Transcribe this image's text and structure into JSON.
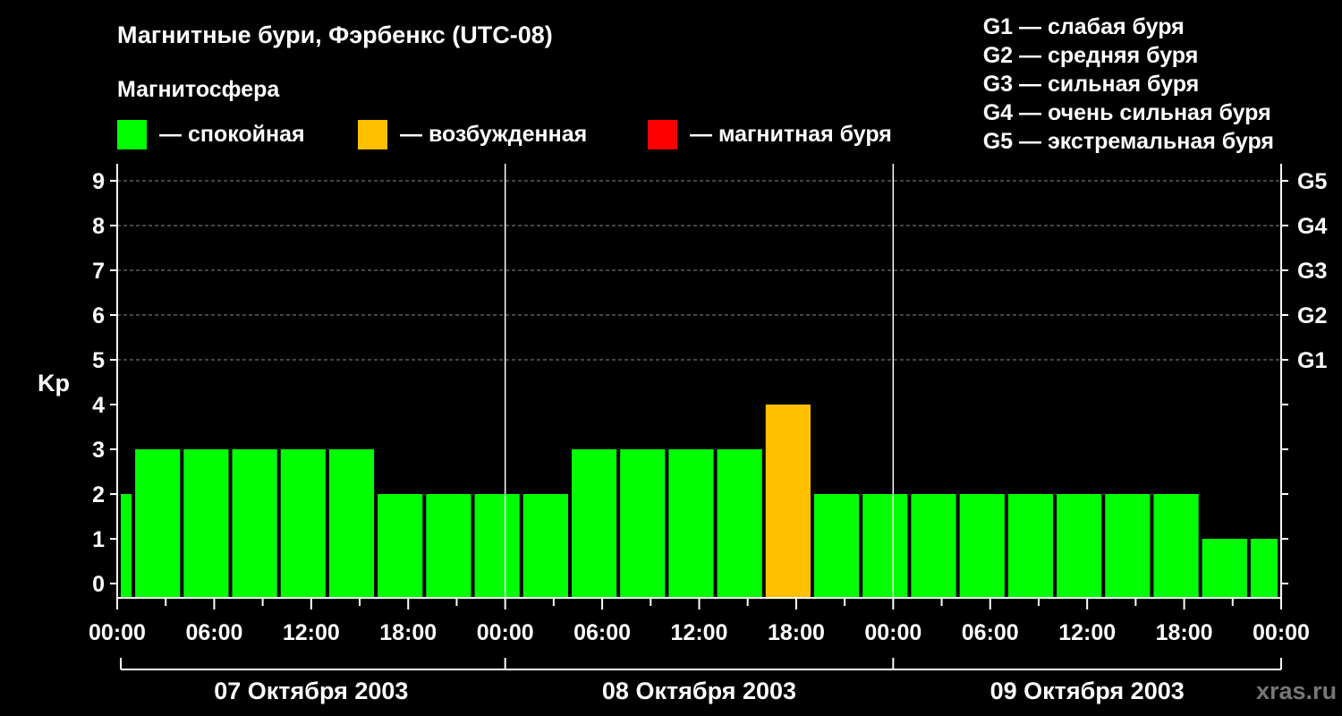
{
  "header": {
    "title": "Магнитные бури, Фэрбенкс (UTC-08)",
    "subtitle": "Магнитосфера"
  },
  "legend": [
    {
      "label": "— спокойная",
      "color": "#00ff00"
    },
    {
      "label": "— возбужденная",
      "color": "#ffc000"
    },
    {
      "label": "— магнитная буря",
      "color": "#ff0000"
    }
  ],
  "storm_scale": [
    "G1 — слабая буря",
    "G2 — средняя буря",
    "G3 — сильная буря",
    "G4 — очень сильная буря",
    "G5 — экстремальная буря"
  ],
  "watermark": "xras.ru",
  "chart_data": {
    "type": "bar",
    "title": "Магнитные бури, Фэрбенкс (UTC-08)",
    "ylabel": "Kp",
    "ylim": [
      0,
      9
    ],
    "yticks": [
      0,
      1,
      2,
      3,
      4,
      5,
      6,
      7,
      8,
      9
    ],
    "y2ticks": [
      {
        "value": 5,
        "label": "G1"
      },
      {
        "value": 6,
        "label": "G2"
      },
      {
        "value": 7,
        "label": "G3"
      },
      {
        "value": 8,
        "label": "G4"
      },
      {
        "value": 9,
        "label": "G5"
      }
    ],
    "grid": "horizontal dashed at Kp 5–9",
    "x_start": "07 Октября 2003 00:00",
    "x_range_hours": [
      0,
      72
    ],
    "xtick_labels": [
      "00:00",
      "06:00",
      "12:00",
      "18:00",
      "00:00",
      "06:00",
      "12:00",
      "18:00",
      "00:00",
      "06:00",
      "12:00",
      "18:00",
      "00:00"
    ],
    "days": [
      "07 Октября 2003",
      "08 Октября 2003",
      "09 Октября 2003"
    ],
    "bars": [
      {
        "start": "07 Октября 2003 00:00",
        "end": "07 Октября 2003 01:00",
        "kp": 2,
        "level": "quiet"
      },
      {
        "start": "07 Октября 2003 01:00",
        "end": "07 Октября 2003 04:00",
        "kp": 3,
        "level": "quiet"
      },
      {
        "start": "07 Октября 2003 04:00",
        "end": "07 Октября 2003 07:00",
        "kp": 3,
        "level": "quiet"
      },
      {
        "start": "07 Октября 2003 07:00",
        "end": "07 Октября 2003 10:00",
        "kp": 3,
        "level": "quiet"
      },
      {
        "start": "07 Октября 2003 10:00",
        "end": "07 Октября 2003 13:00",
        "kp": 3,
        "level": "quiet"
      },
      {
        "start": "07 Октября 2003 13:00",
        "end": "07 Октября 2003 16:00",
        "kp": 3,
        "level": "quiet"
      },
      {
        "start": "07 Октября 2003 16:00",
        "end": "07 Октября 2003 19:00",
        "kp": 2,
        "level": "quiet"
      },
      {
        "start": "07 Октября 2003 19:00",
        "end": "07 Октября 2003 22:00",
        "kp": 2,
        "level": "quiet"
      },
      {
        "start": "07 Октября 2003 22:00",
        "end": "08 Октября 2003 01:00",
        "kp": 2,
        "level": "quiet"
      },
      {
        "start": "08 Октября 2003 01:00",
        "end": "08 Октября 2003 04:00",
        "kp": 2,
        "level": "quiet"
      },
      {
        "start": "08 Октября 2003 04:00",
        "end": "08 Октября 2003 07:00",
        "kp": 3,
        "level": "quiet"
      },
      {
        "start": "08 Октября 2003 07:00",
        "end": "08 Октября 2003 10:00",
        "kp": 3,
        "level": "quiet"
      },
      {
        "start": "08 Октября 2003 10:00",
        "end": "08 Октября 2003 13:00",
        "kp": 3,
        "level": "quiet"
      },
      {
        "start": "08 Октября 2003 13:00",
        "end": "08 Октября 2003 16:00",
        "kp": 3,
        "level": "quiet"
      },
      {
        "start": "08 Октября 2003 16:00",
        "end": "08 Октября 2003 19:00",
        "kp": 4,
        "level": "active"
      },
      {
        "start": "08 Октября 2003 19:00",
        "end": "08 Октября 2003 22:00",
        "kp": 2,
        "level": "quiet"
      },
      {
        "start": "08 Октября 2003 22:00",
        "end": "09 Октября 2003 01:00",
        "kp": 2,
        "level": "quiet"
      },
      {
        "start": "09 Октября 2003 01:00",
        "end": "09 Октября 2003 04:00",
        "kp": 2,
        "level": "quiet"
      },
      {
        "start": "09 Октября 2003 04:00",
        "end": "09 Октября 2003 07:00",
        "kp": 2,
        "level": "quiet"
      },
      {
        "start": "09 Октября 2003 07:00",
        "end": "09 Октября 2003 10:00",
        "kp": 2,
        "level": "quiet"
      },
      {
        "start": "09 Октября 2003 10:00",
        "end": "09 Октября 2003 13:00",
        "kp": 2,
        "level": "quiet"
      },
      {
        "start": "09 Октября 2003 13:00",
        "end": "09 Октября 2003 16:00",
        "kp": 2,
        "level": "quiet"
      },
      {
        "start": "09 Октября 2003 16:00",
        "end": "09 Октября 2003 19:00",
        "kp": 2,
        "level": "quiet"
      },
      {
        "start": "09 Октября 2003 19:00",
        "end": "09 Октября 2003 22:00",
        "kp": 1,
        "level": "quiet"
      },
      {
        "start": "09 Октября 2003 22:00",
        "end": "10 Октября 2003 00:00",
        "kp": 1,
        "level": "quiet"
      }
    ],
    "level_colors": {
      "quiet": "#00ff00",
      "active": "#ffc000",
      "storm": "#ff0000"
    }
  }
}
